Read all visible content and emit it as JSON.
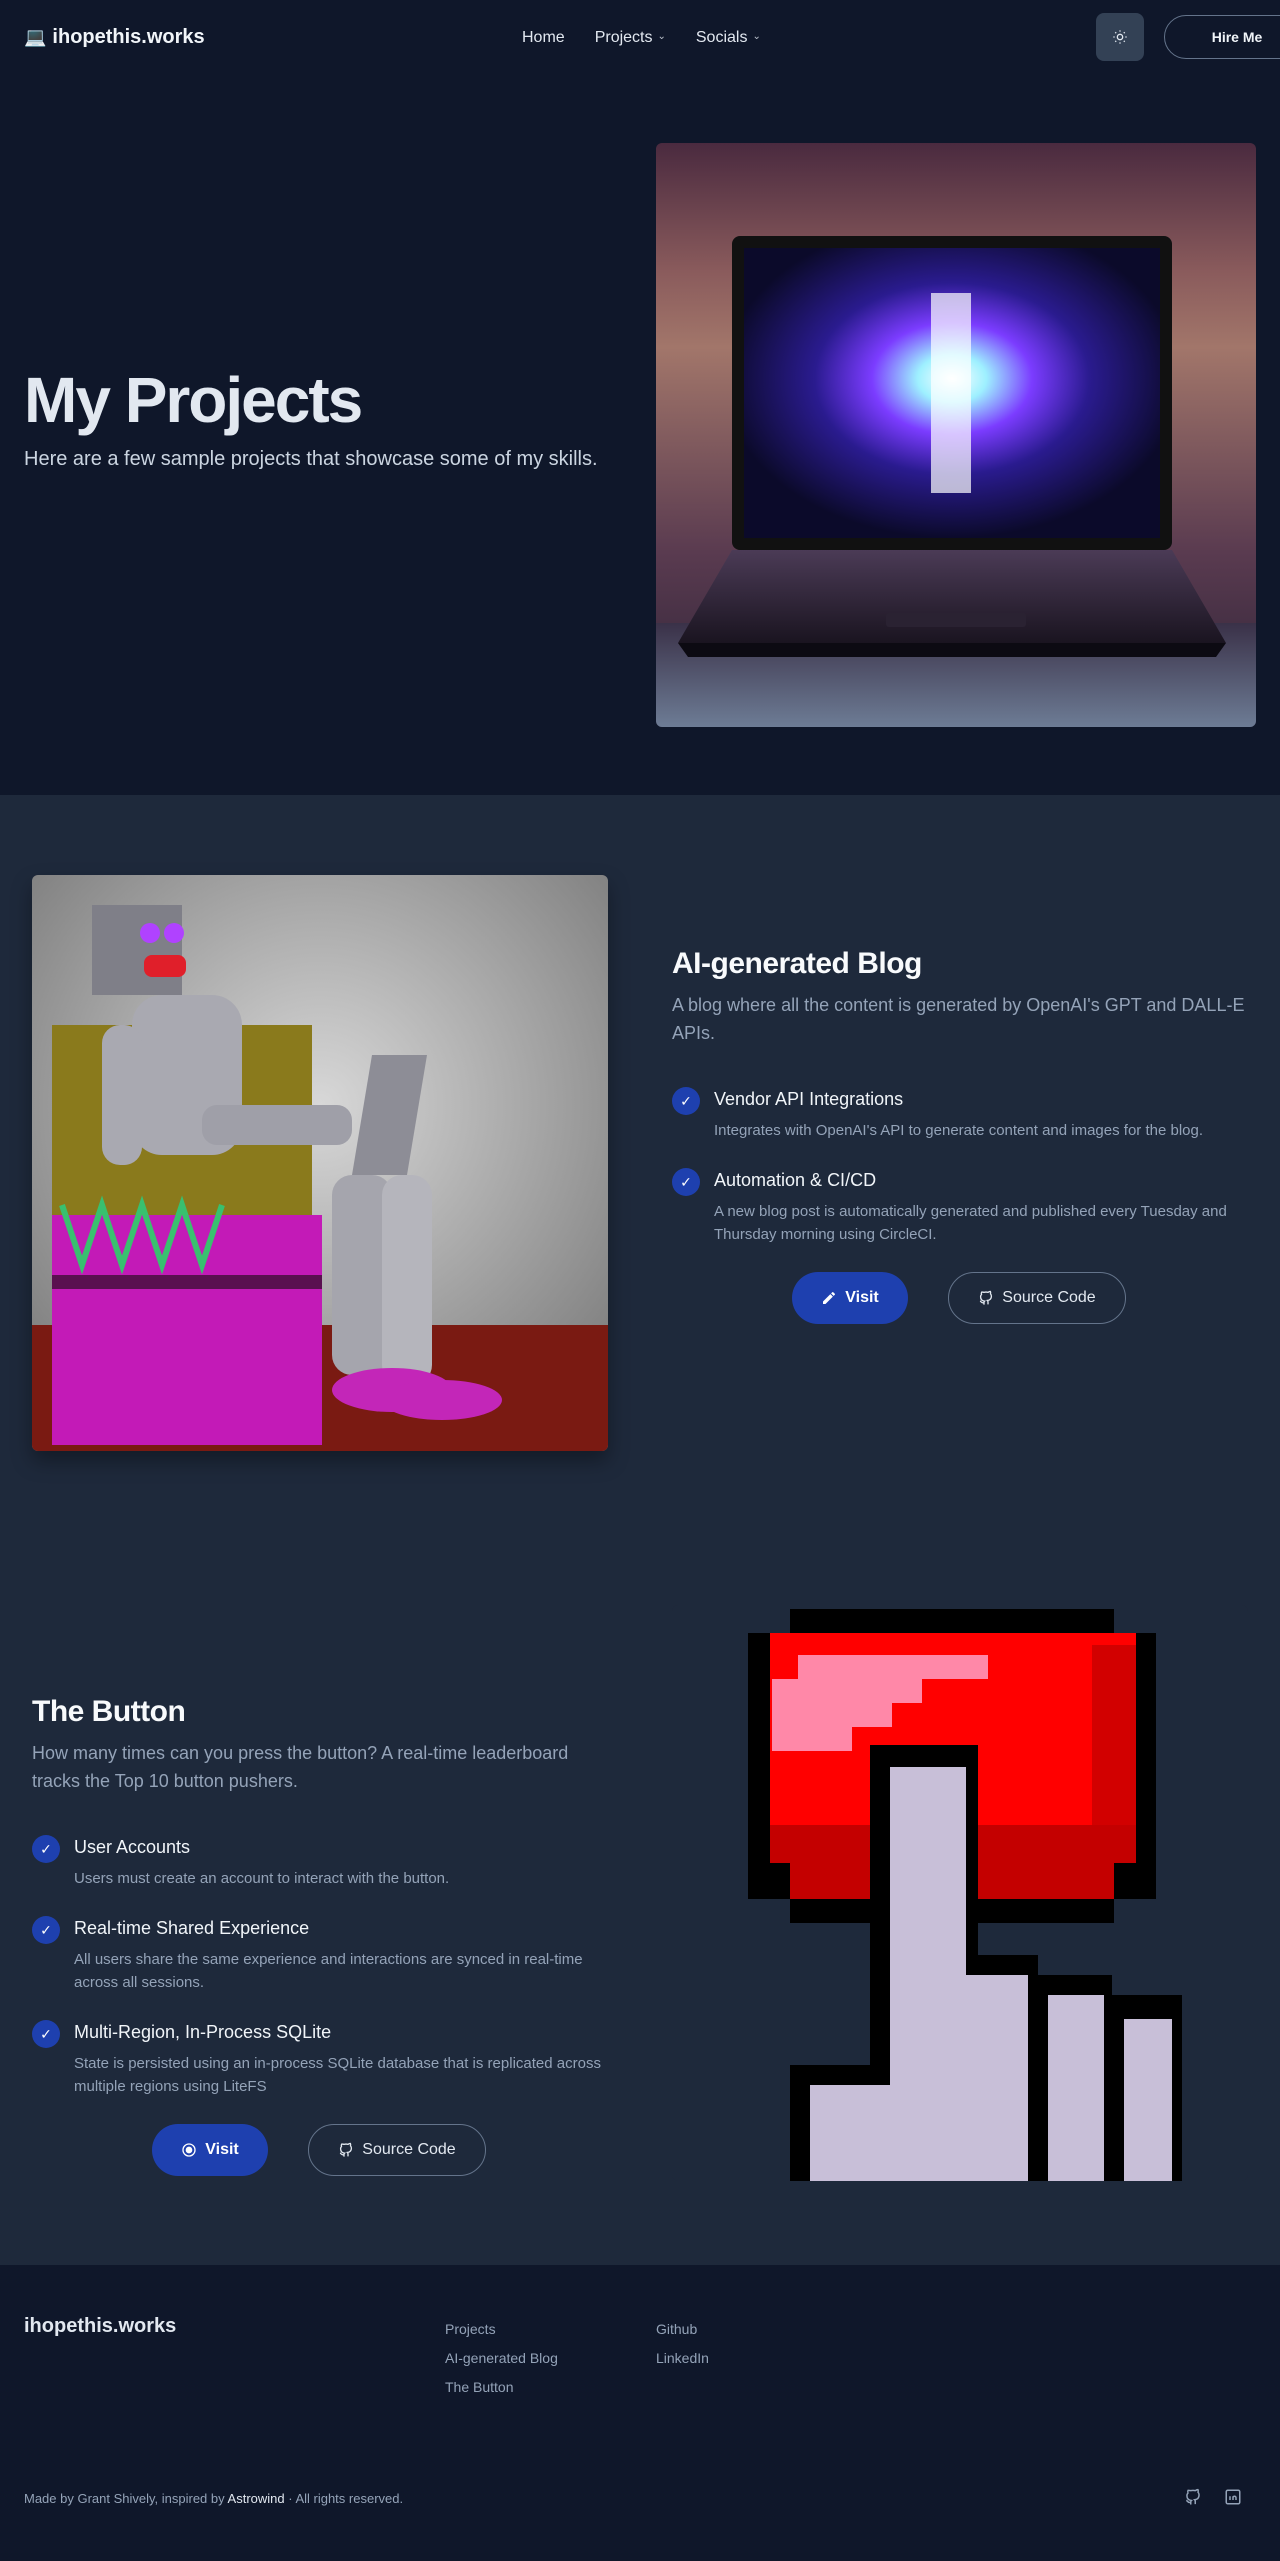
{
  "header": {
    "brand": "ihopethis.works",
    "nav": [
      {
        "label": "Home",
        "dropdown": false
      },
      {
        "label": "Projects",
        "dropdown": true
      },
      {
        "label": "Socials",
        "dropdown": true
      }
    ],
    "theme_icon": "sun-icon",
    "hire_label": "Hire Me"
  },
  "hero": {
    "title": "My Projects",
    "subtitle": "Here are a few sample projects that showcase some of my skills."
  },
  "projects": [
    {
      "title": "AI-generated Blog",
      "description": "A blog where all the content is generated by OpenAI's GPT and DALL-E APIs.",
      "features": [
        {
          "title": "Vendor API Integrations",
          "description": "Integrates with OpenAI's API to generate content and images for the blog."
        },
        {
          "title": "Automation & CI/CD",
          "description": "A new blog post is automatically generated and published every Tuesday and Thursday morning using CircleCI."
        }
      ],
      "visit_label": "Visit",
      "source_label": "Source Code"
    },
    {
      "title": "The Button",
      "description": "How many times can you press the button? A real-time leaderboard tracks the Top 10 button pushers.",
      "features": [
        {
          "title": "User Accounts",
          "description": "Users must create an account to interact with the button."
        },
        {
          "title": "Real-time Shared Experience",
          "description": "All users share the same experience and interactions are synced in real-time across all sessions."
        },
        {
          "title": "Multi-Region, In-Process SQLite",
          "description": "State is persisted using an in-process SQLite database that is replicated across multiple regions using LiteFS"
        }
      ],
      "visit_label": "Visit",
      "source_label": "Source Code"
    }
  ],
  "footer": {
    "brand": "ihopethis.works",
    "col1": [
      "Projects",
      "AI-generated Blog",
      "The Button"
    ],
    "col2": [
      "Github",
      "LinkedIn"
    ],
    "bottom_prefix": "Made by Grant Shively, inspired by ",
    "bottom_link": "Astrowind",
    "bottom_suffix": " · All rights reserved."
  },
  "colors": {
    "page_bg": "#0f172a",
    "section_bg": "#1e293b",
    "accent": "#1e40af"
  }
}
